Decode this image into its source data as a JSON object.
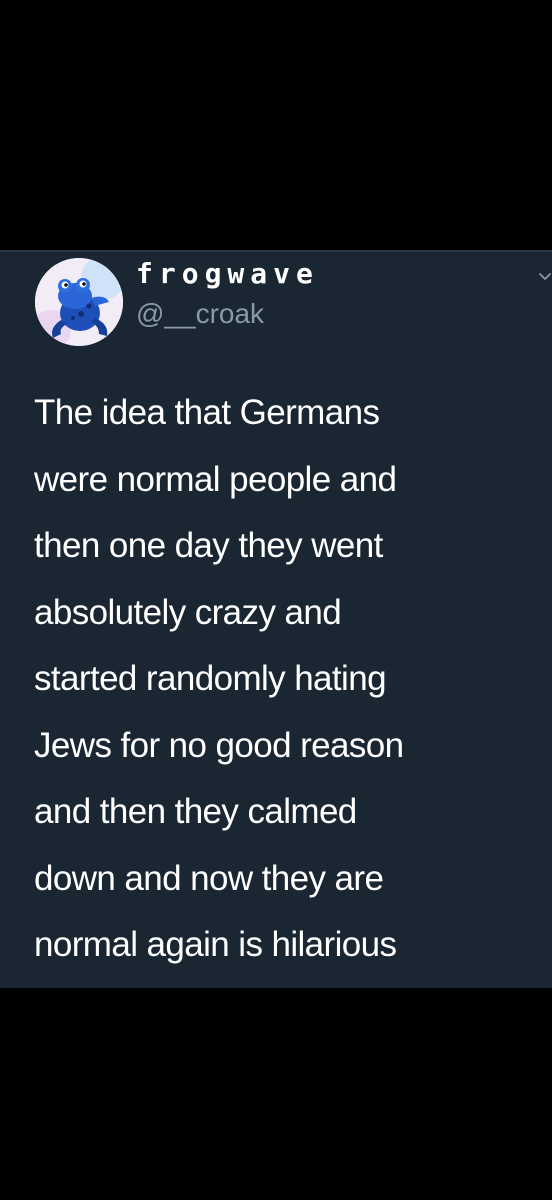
{
  "tweet": {
    "display_name": "frogwave",
    "handle": "@__croak",
    "text_lines": [
      "The idea that Germans",
      "were normal people and",
      "then one day they went",
      "absolutely crazy and",
      "started randomly hating",
      "Jews for no good reason",
      "and then they calmed",
      "down and now they are",
      "normal again is hilarious"
    ]
  },
  "icons": {
    "avatar": "frog-avatar",
    "more": "chevron-down-icon"
  },
  "colors": {
    "page_background": "#000000",
    "card_background": "#1b2633",
    "text": "#ffffff",
    "secondary_text": "#8899a6"
  }
}
